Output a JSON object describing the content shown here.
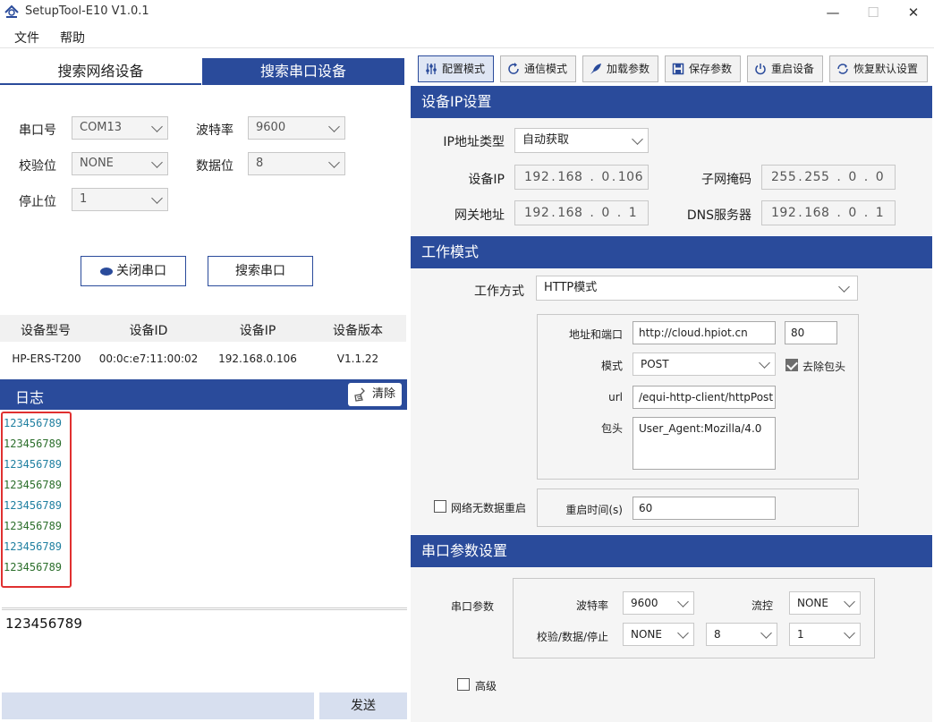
{
  "window": {
    "title": "SetupTool-E10 V1.0.1",
    "minimize": "—",
    "maximize": "☐",
    "close": "✕"
  },
  "menu": {
    "file": "文件",
    "help": "帮助"
  },
  "left_tabs": {
    "network": "搜索网络设备",
    "serial": "搜索串口设备"
  },
  "serial": {
    "port_label": "串口号",
    "port_value": "COM13",
    "baud_label": "波特率",
    "baud_value": "9600",
    "parity_label": "校验位",
    "parity_value": "NONE",
    "databits_label": "数据位",
    "databits_value": "8",
    "stopbits_label": "停止位",
    "stopbits_value": "1"
  },
  "buttons": {
    "close_port": "关闭串口",
    "search_port": "搜索串口"
  },
  "device_table": {
    "headers": [
      "设备型号",
      "设备ID",
      "设备IP",
      "设备版本"
    ],
    "rows": [
      [
        "HP-ERS-T200",
        "00:0c:e7:11:00:02",
        "192.168.0.106",
        "V1.1.22"
      ]
    ]
  },
  "log": {
    "title": "日志",
    "clear": "清除",
    "lines": [
      "123456789",
      "123456789",
      "123456789",
      "123456789",
      "123456789",
      "123456789",
      "123456789",
      "123456789"
    ]
  },
  "send": {
    "text": "123456789",
    "button": "发送"
  },
  "toolbar": [
    "配置模式",
    "通信模式",
    "加载参数",
    "保存参数",
    "重启设备",
    "恢复默认设置"
  ],
  "ip_section": {
    "title": "设备IP设置",
    "ip_type_label": "IP地址类型",
    "ip_type_value": "自动获取",
    "device_ip_label": "设备IP",
    "device_ip": [
      "192",
      "168",
      "0",
      "106"
    ],
    "subnet_label": "子网掩码",
    "subnet": [
      "255",
      "255",
      "0",
      "0"
    ],
    "gateway_label": "网关地址",
    "gateway": [
      "192",
      "168",
      "0",
      "1"
    ],
    "dns_label": "DNS服务器",
    "dns": [
      "192",
      "168",
      "0",
      "1"
    ]
  },
  "work_section": {
    "title": "工作模式",
    "method_label": "工作方式",
    "method_value": "HTTP模式",
    "addr_label": "地址和端口",
    "addr_value": "http://cloud.hpiot.cn",
    "port_value": "80",
    "mode_label": "模式",
    "mode_value": "POST",
    "strip_header_label": "去除包头",
    "strip_header_checked": true,
    "url_label": "url",
    "url_value": "/equi-http-client/httpPost",
    "header_label": "包头",
    "header_value": "User_Agent:Mozilla/4.0",
    "no_data_restart_label": "网络无数据重启",
    "no_data_restart_checked": false,
    "restart_time_label": "重启时间(s)",
    "restart_time_value": "60"
  },
  "serial_section": {
    "title": "串口参数设置",
    "params_label": "串口参数",
    "baud_label": "波特率",
    "baud_value": "9600",
    "flow_label": "流控",
    "flow_value": "NONE",
    "pds_label": "校验/数据/停止",
    "parity_value": "NONE",
    "data_value": "8",
    "stop_value": "1",
    "advanced_label": "高级",
    "advanced_checked": false
  },
  "colors": {
    "accent": "#2a4b9b",
    "log_red_box": "#e03030",
    "log_teal": "#1f7fa0",
    "log_green": "#2b6e2b"
  }
}
